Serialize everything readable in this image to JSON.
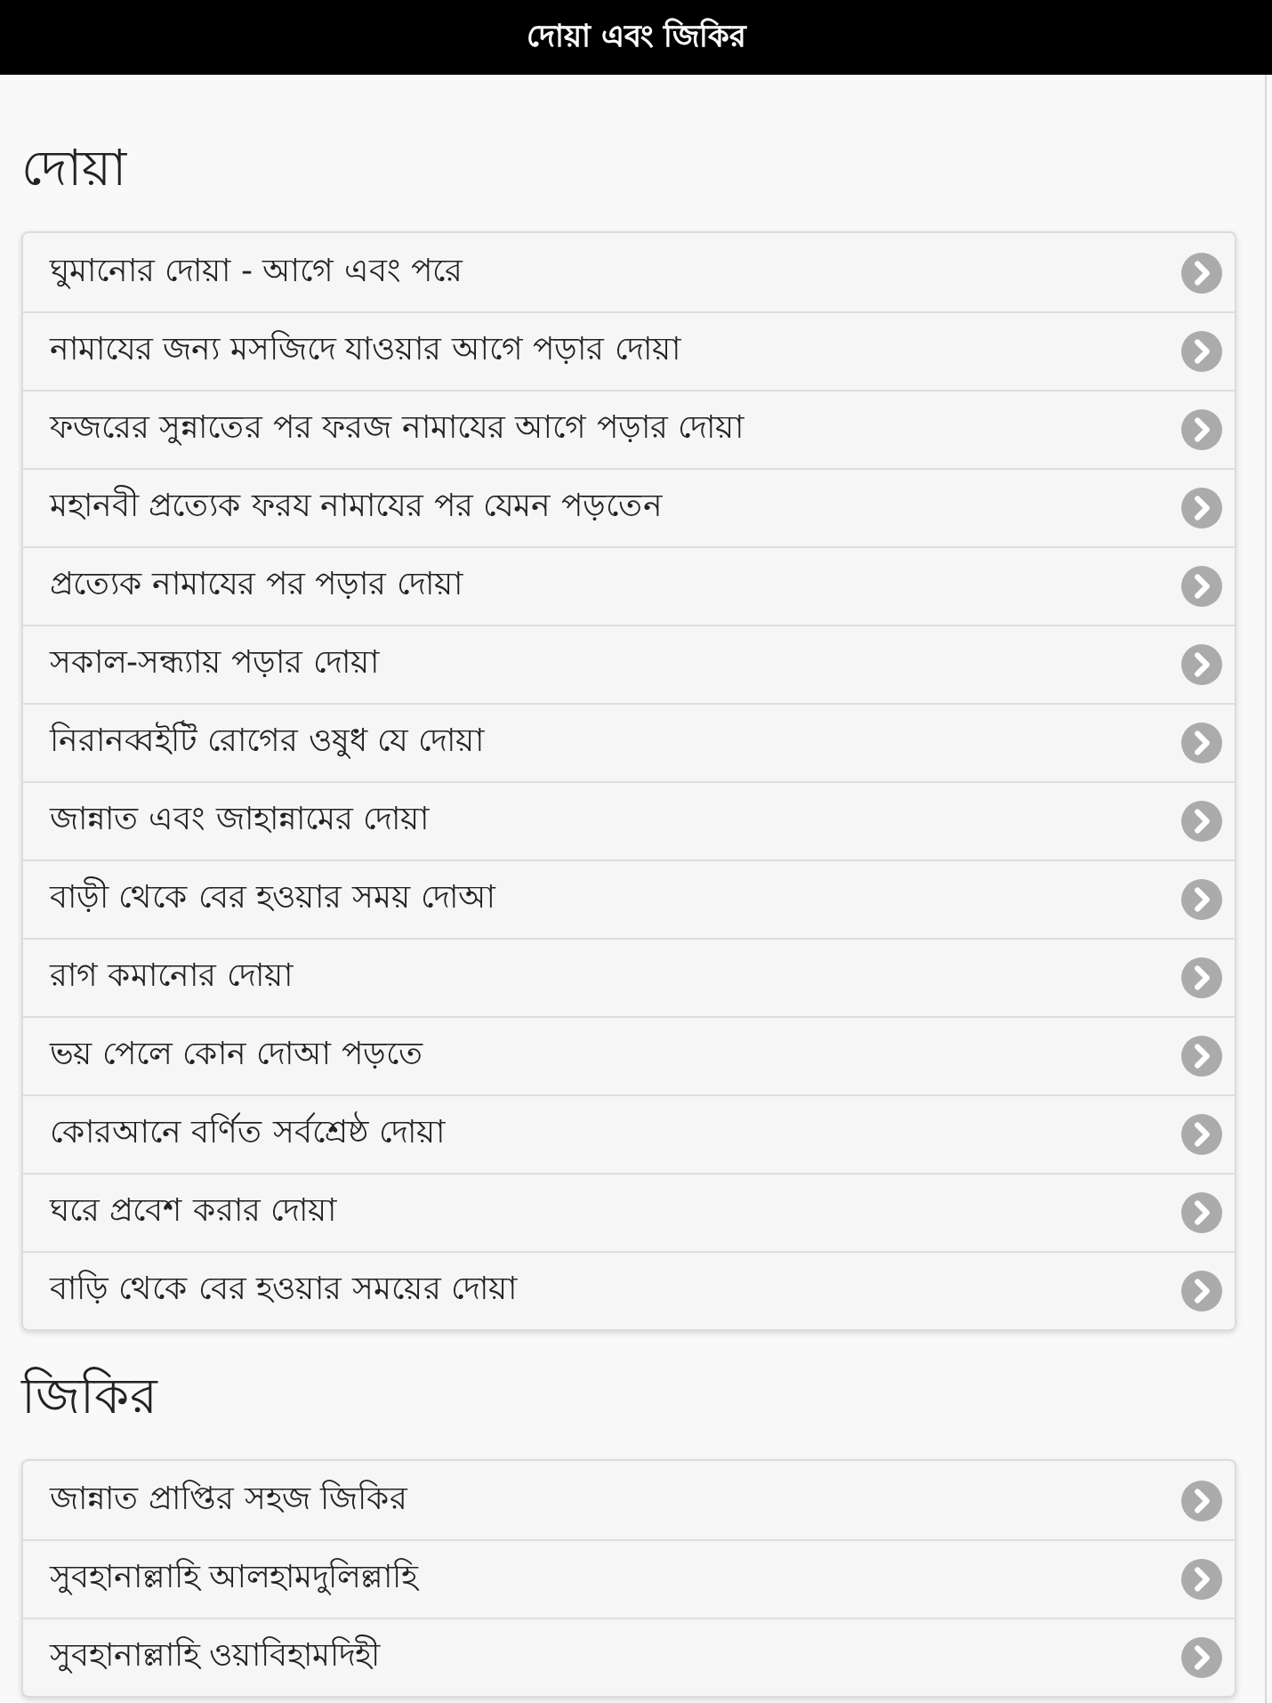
{
  "header": {
    "title": "দোয়া এবং জিকির"
  },
  "sections": [
    {
      "heading": "দোয়া",
      "items": [
        "ঘুমানোর দোয়া - আগে এবং পরে",
        "নামাযের জন্য মসজিদে যাওয়ার আগে পড়ার দোয়া",
        "ফজরের সুন্নাতের পর ফরজ নামাযের আগে পড়ার দোয়া",
        "মহানবী প্রত্যেক ফরয নামাযের পর যেমন পড়তেন",
        "প্রত্যেক নামাযের পর পড়ার দোয়া",
        "সকাল-সন্ধ্যায় পড়ার দোয়া",
        "নিরানব্বইটি রোগের ওষুধ যে দোয়া",
        "জান্নাত এবং জাহান্নামের দোয়া",
        "বাড়ী থেকে বের হওয়ার সময় দোআ",
        "রাগ কমানোর দোয়া",
        "ভয় পেলে কোন দোআ পড়তে",
        "কোরআনে বর্ণিত সর্বশ্রেষ্ঠ দোয়া",
        "ঘরে প্রবেশ করার দোয়া",
        "বাড়ি থেকে বের হওয়ার সময়ের দোয়া"
      ]
    },
    {
      "heading": "জিকির",
      "items": [
        "জান্নাত প্রাপ্তির সহজ জিকির",
        "সুবহানাল্লাহি আলহামদুলিল্লাহি",
        "সুবহানাল্লাহি ওয়াবিহামদিহী"
      ]
    }
  ]
}
